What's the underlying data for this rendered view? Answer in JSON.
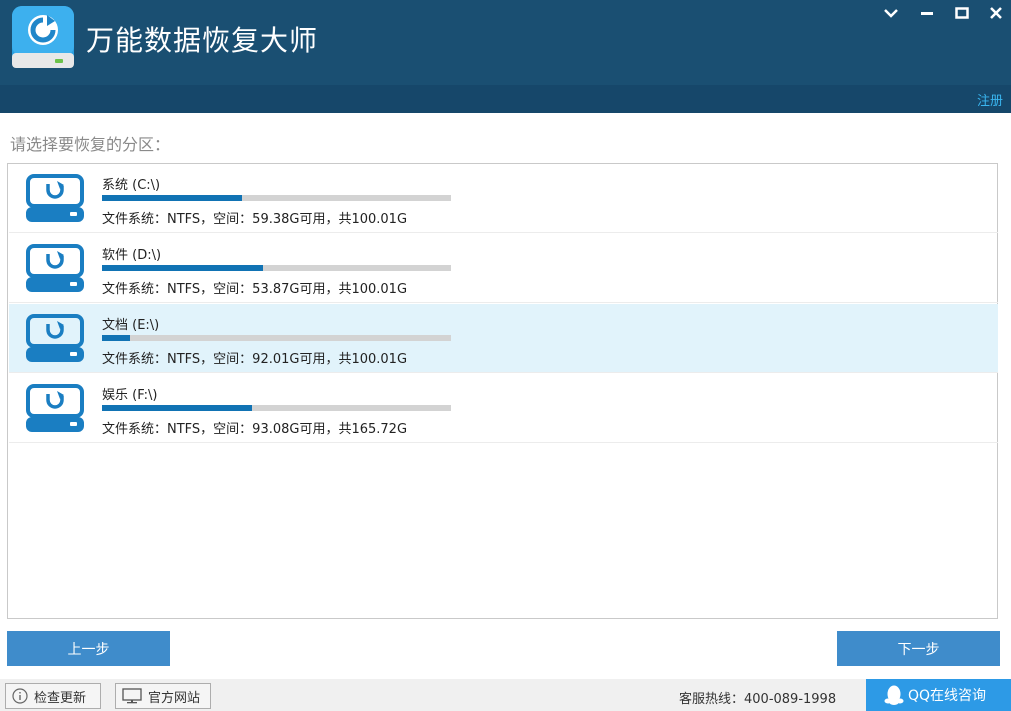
{
  "app": {
    "title": "万能数据恢复大师",
    "register_label": "注册"
  },
  "prompt": "请选择要恢复的分区：",
  "partitions": [
    {
      "name": "系统 (C:\\)",
      "info": "文件系统：NTFS，空间：59.38G可用，共100.01G",
      "used_fraction": 0.4
    },
    {
      "name": "软件 (D:\\)",
      "info": "文件系统：NTFS，空间：53.87G可用，共100.01G",
      "used_fraction": 0.46
    },
    {
      "name": "文档 (E:\\)",
      "info": "文件系统：NTFS，空间：92.01G可用，共100.01G",
      "used_fraction": 0.08,
      "selected": true
    },
    {
      "name": "娱乐 (F:\\)",
      "info": "文件系统：NTFS，空间：93.08G可用，共165.72G",
      "used_fraction": 0.43
    }
  ],
  "buttons": {
    "prev_label": "上一步",
    "next_label": "下一步"
  },
  "footer": {
    "check_update_label": "检查更新",
    "official_site_label": "官方网站",
    "hotline": "客服热线：400-089-1998",
    "qq_label": "QQ在线咨询"
  },
  "colors": {
    "titlebar": "#1a4f72",
    "accent": "#1173b4",
    "button": "#3f8ccb",
    "selected_row": "#e1f3fb",
    "register_link": "#3ab6f0"
  },
  "icons": [
    "app-logo-icon",
    "chevron-down-icon",
    "minimize-icon",
    "maximize-icon",
    "close-icon",
    "drive-recovery-icon",
    "info-icon",
    "monitor-icon",
    "qq-penguin-icon"
  ]
}
